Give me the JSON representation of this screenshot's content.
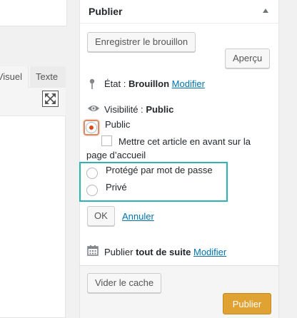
{
  "editor": {
    "tab_visual": "Visuel",
    "tab_text": "Texte"
  },
  "panel": {
    "title": "Publier",
    "save_draft": "Enregistrer le brouillon",
    "preview": "Aperçu",
    "status_label": "État :",
    "status_value": "Brouillon",
    "status_edit": "Modifier",
    "visibility_label": "Visibilité :",
    "visibility_value": "Public",
    "options": {
      "public": "Public",
      "sticky": "Mettre cet article en avant sur la",
      "sticky_line2": "page d’accueil",
      "password": "Protégé par mot de passe",
      "private": "Privé"
    },
    "ok": "OK",
    "cancel": "Annuler",
    "publish_label": "Publier",
    "publish_when": "tout de suite",
    "publish_edit": "Modifier",
    "clear_cache": "Vider le cache",
    "publish_button": "Publier"
  },
  "colors": {
    "link": "#0073aa",
    "primary": "#e0a333",
    "highlight": "#2bb3b6",
    "radio_selected": "#d54e21"
  }
}
